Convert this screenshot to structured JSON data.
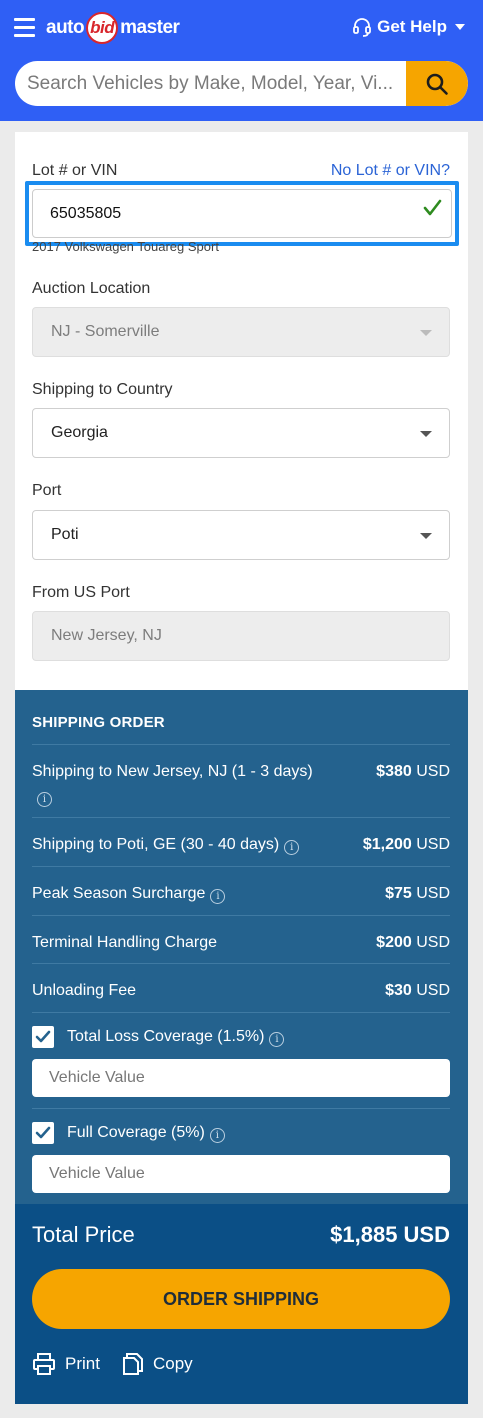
{
  "header": {
    "logo_auto": "auto",
    "logo_bid": "bid",
    "logo_master": "master",
    "get_help": "Get Help",
    "search_placeholder": "Search Vehicles by Make, Model, Year, Vi..."
  },
  "form": {
    "lot_label": "Lot # or VIN",
    "no_lot_link": "No Lot # or VIN?",
    "lot_value": "65035805",
    "vehicle_name": "2017 Volkswagen Touareg Sport",
    "auction_label": "Auction Location",
    "auction_value": "NJ - Somerville",
    "country_label": "Shipping to Country",
    "country_value": "Georgia",
    "port_label": "Port",
    "port_value": "Poti",
    "from_port_label": "From US Port",
    "from_port_value": "New Jersey, NJ"
  },
  "order": {
    "title": "SHIPPING ORDER",
    "currency": "USD",
    "items": [
      {
        "name": "Shipping to New Jersey, NJ (1 - 3 days)",
        "price": "$380",
        "currency": "USD"
      },
      {
        "name": "Shipping to Poti, GE (30 - 40 days)",
        "price": "$1,200",
        "currency": "USD"
      },
      {
        "name": "Peak Season Surcharge",
        "price": "$75",
        "currency": "USD"
      },
      {
        "name": "Terminal Handling Charge",
        "price": "$200",
        "currency": "USD"
      },
      {
        "name": "Unloading Fee",
        "price": "$30",
        "currency": "USD"
      }
    ],
    "total_loss_label": "Total Loss Coverage (1.5%)",
    "total_loss_checked": true,
    "full_coverage_label": "Full Coverage (5%)",
    "full_coverage_checked": true,
    "vehicle_value_placeholder": "Vehicle Value"
  },
  "total": {
    "label": "Total Price",
    "price": "$1,885 USD",
    "order_button": "ORDER SHIPPING",
    "print_label": "Print",
    "copy_label": "Copy"
  },
  "colors": {
    "header_blue": "#2f5ff5",
    "accent_orange": "#f6a500",
    "order_bg": "#24628e",
    "total_bg": "#0b4f86",
    "focus_ring": "#1a8cf0"
  }
}
